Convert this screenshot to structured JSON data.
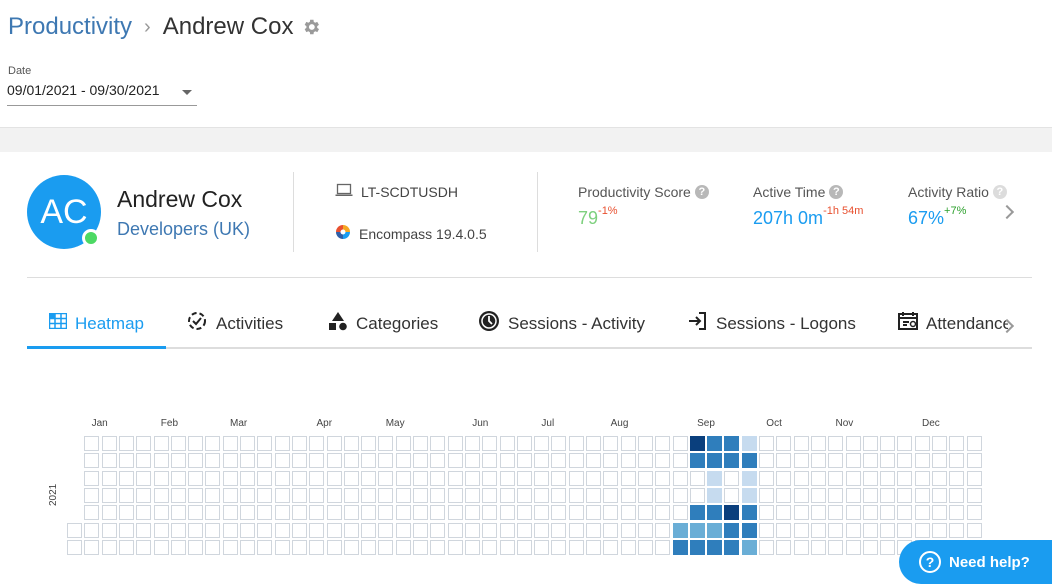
{
  "breadcrumb": {
    "parent": "Productivity",
    "separator": "›",
    "current": "Andrew Cox"
  },
  "date_filter": {
    "label": "Date",
    "value": "09/01/2021 - 09/30/2021"
  },
  "user": {
    "initials": "AC",
    "name": "Andrew Cox",
    "team": "Developers (UK)",
    "status": "online"
  },
  "device": {
    "computer": "LT-SCDTUSDH",
    "app": "Encompass 19.4.0.5"
  },
  "metrics": [
    {
      "label": "Productivity Score",
      "value": "79",
      "delta": "-1%",
      "value_color": "#7ed07e",
      "delta_color": "#e8502f"
    },
    {
      "label": "Active Time",
      "value": "207h 0m",
      "delta": "-1h 54m",
      "value_color": "#1a9cf0",
      "delta_color": "#e8502f"
    },
    {
      "label": "Activity Ratio",
      "value": "67%",
      "delta": "+7%",
      "value_color": "#1a9cf0",
      "delta_color": "#2ca02c"
    }
  ],
  "tabs": [
    {
      "label": "Heatmap",
      "icon": "grid-icon",
      "active": true
    },
    {
      "label": "Activities",
      "icon": "activities-icon",
      "active": false
    },
    {
      "label": "Categories",
      "icon": "shapes-icon",
      "active": false
    },
    {
      "label": "Sessions - Activity",
      "icon": "clock-icon",
      "active": false
    },
    {
      "label": "Sessions - Logons",
      "icon": "login-icon",
      "active": false
    },
    {
      "label": "Attendance",
      "icon": "attendance-icon",
      "active": false
    }
  ],
  "heatmap": {
    "year": "2021",
    "months": [
      "Jan",
      "Feb",
      "Mar",
      "Apr",
      "May",
      "Jun",
      "Jul",
      "Aug",
      "Sep",
      "Oct",
      "Nov",
      "Dec"
    ],
    "colors": [
      "#ffffff",
      "#c6dbef",
      "#6aaed6",
      "#2f7ebc",
      "#0a3f7d"
    ],
    "active_weeks": [
      {
        "week": 35,
        "levels": [
          0,
          0,
          0,
          0,
          0,
          2,
          3
        ]
      },
      {
        "week": 36,
        "levels": [
          4,
          3,
          0,
          0,
          3,
          2,
          3
        ]
      },
      {
        "week": 37,
        "levels": [
          3,
          3,
          1,
          1,
          3,
          2,
          3
        ]
      },
      {
        "week": 38,
        "levels": [
          3,
          3,
          0,
          0,
          4,
          3,
          3
        ]
      },
      {
        "week": 39,
        "levels": [
          1,
          3,
          1,
          1,
          3,
          3,
          2
        ]
      }
    ]
  },
  "help_button": {
    "icon": "question-icon",
    "label": "Need help?"
  }
}
